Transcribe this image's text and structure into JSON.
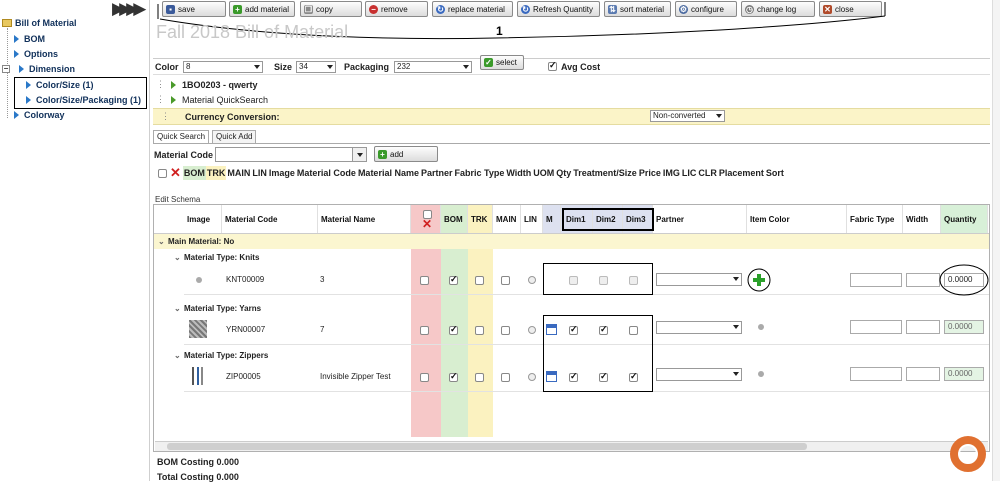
{
  "tree": {
    "root": "Bill of Material",
    "items": [
      "BOM",
      "Options",
      "Dimension",
      "Color/Size (1)",
      "Color/Size/Packaging (1)",
      "Colorway"
    ]
  },
  "toolbar": {
    "buttons": [
      "save",
      "add material",
      "copy",
      "remove",
      "replace material",
      "Refresh Quantity",
      "sort material",
      "configure",
      "change log",
      "close"
    ]
  },
  "page_title": "Fall 2018 Bill of Material",
  "annotation_label": "1",
  "filters": {
    "color_label": "Color",
    "color_value": "8",
    "size_label": "Size",
    "size_value": "34",
    "packaging_label": "Packaging",
    "packaging_value": "232",
    "select_label": "select",
    "avg_cost_label": "Avg Cost",
    "avg_cost_checked": true
  },
  "sections": {
    "product": "1BO0203 - qwerty",
    "material_quicksearch": "Material QuickSearch",
    "currency_label": "Currency Conversion:",
    "currency_value": "Non-converted"
  },
  "tabs": [
    "Quick Search",
    "Quick Add"
  ],
  "quick_search": {
    "material_code_label": "Material Code",
    "add_label": "add"
  },
  "column_toggle": [
    "BOM",
    "TRK",
    "MAIN",
    "LIN",
    "Image",
    "Material Code",
    "Material Name",
    "Partner",
    "Fabric Type",
    "Width",
    "UOM",
    "Qty",
    "Treatment/Size",
    "Price",
    "IMG",
    "LIC",
    "CLR",
    "Placement",
    "Sort"
  ],
  "schema_label": "Edit Schema",
  "grid": {
    "headers": {
      "image": "Image",
      "material_code": "Material Code",
      "material_name": "Material Name",
      "bom": "BOM",
      "trk": "TRK",
      "main": "MAIN",
      "lin": "LIN",
      "m": "M",
      "dim1": "Dim1",
      "dim2": "Dim2",
      "dim3": "Dim3",
      "partner": "Partner",
      "item_color": "Item Color",
      "fabric_type": "Fabric Type",
      "width": "Width",
      "quantity": "Quantity"
    },
    "main_group": "Main Material: No",
    "rows": [
      {
        "group": "Material Type: Knits",
        "code": "KNT00009",
        "name": "3",
        "quantity": "0.0000"
      },
      {
        "group": "Material Type: Yarns",
        "code": "YRN00007",
        "name": "7",
        "quantity": "0.0000"
      },
      {
        "group": "Material Type: Zippers",
        "code": "ZIP00005",
        "name": "Invisible Zipper Test",
        "quantity": "0.0000"
      }
    ]
  },
  "footer": {
    "bom_costing": "BOM Costing 0.000",
    "total_costing": "Total Costing 0.000"
  },
  "colors": {
    "accent_blue": "#2a78c8",
    "red_band": "#f6c8c8",
    "green_band": "#d8eed0",
    "yellow_band": "#fbf2c0",
    "currency_band": "#fbf4c8"
  }
}
